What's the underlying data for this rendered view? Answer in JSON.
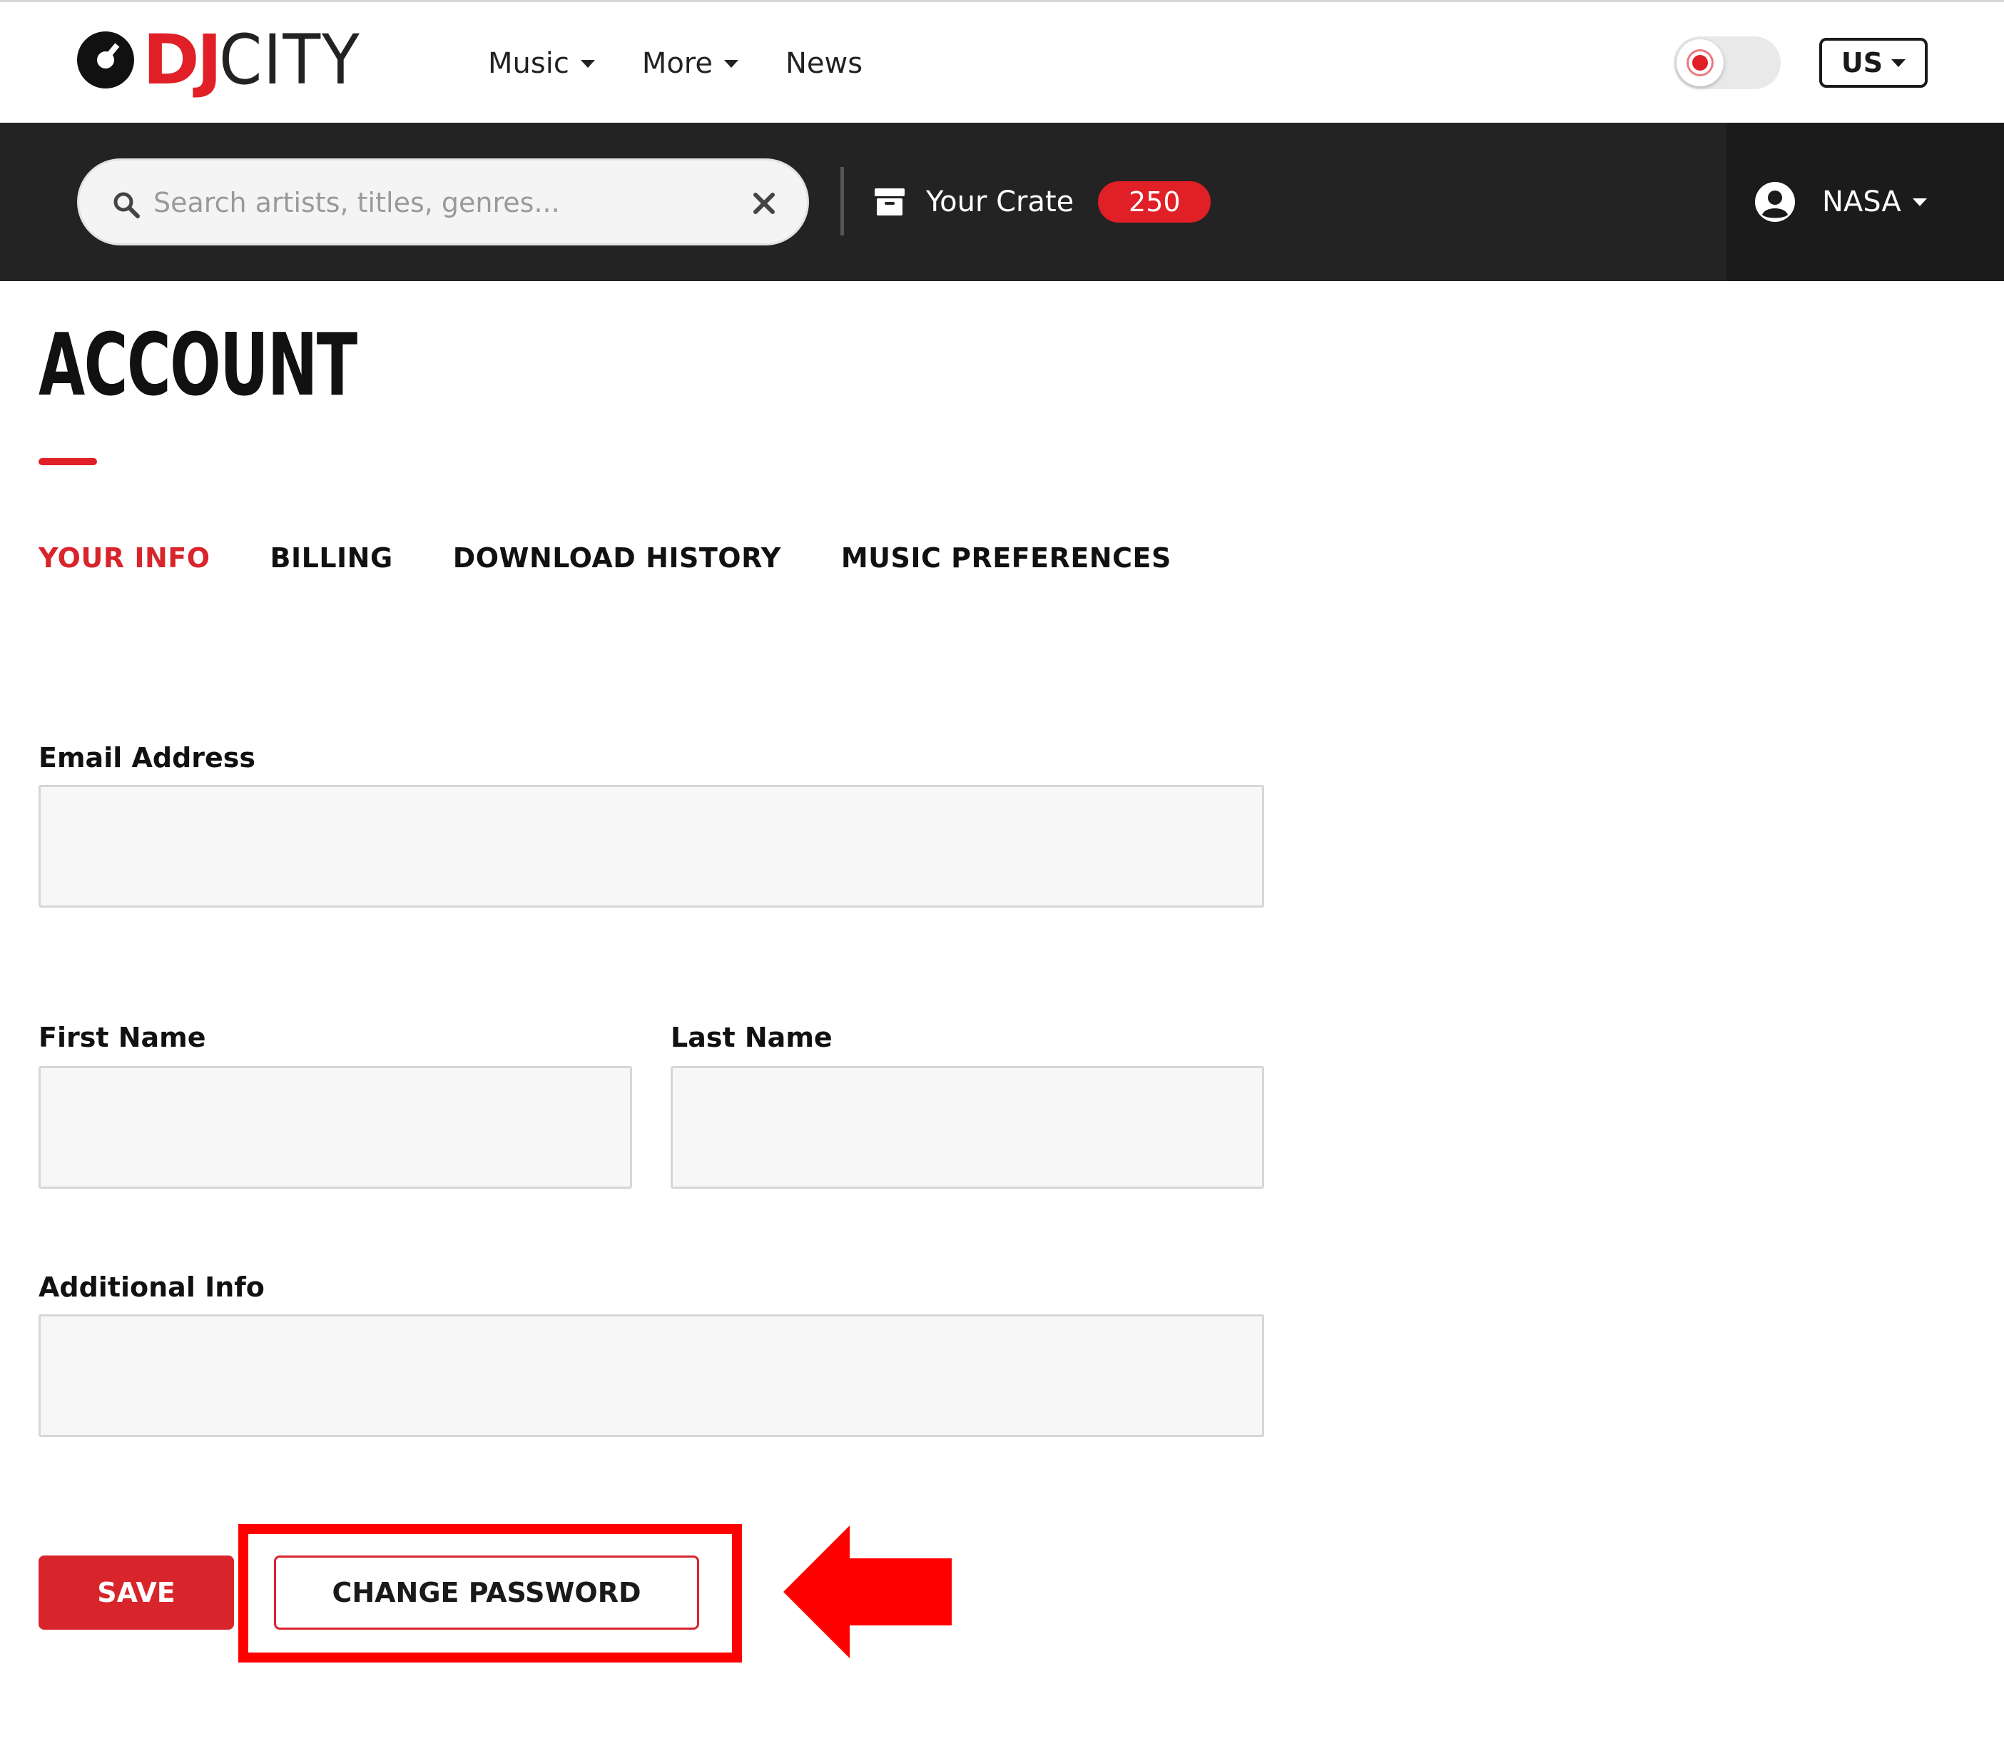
{
  "brand": {
    "logo_primary": "DJ",
    "logo_secondary": "CITY"
  },
  "nav": {
    "links": [
      {
        "label": "Music",
        "has_dropdown": true
      },
      {
        "label": "More",
        "has_dropdown": true
      },
      {
        "label": "News",
        "has_dropdown": false
      }
    ],
    "theme_toggle_icon": "sun-icon",
    "region_label": "US"
  },
  "toolbar": {
    "search_placeholder": "Search artists, titles, genres...",
    "search_value": "",
    "crate_label": "Your Crate",
    "crate_count": "250",
    "user_name": "NASA"
  },
  "page": {
    "title": "ACCOUNT",
    "tabs": [
      {
        "label": "YOUR INFO",
        "active": true
      },
      {
        "label": "BILLING",
        "active": false
      },
      {
        "label": "DOWNLOAD HISTORY",
        "active": false
      },
      {
        "label": "MUSIC PREFERENCES",
        "active": false
      }
    ]
  },
  "form": {
    "email_label": "Email Address",
    "email_value": "",
    "first_name_label": "First Name",
    "first_name_value": "",
    "last_name_label": "Last Name",
    "last_name_value": "",
    "additional_info_label": "Additional Info",
    "additional_info_value": "",
    "save_label": "SAVE",
    "change_password_label": "CHANGE PASSWORD"
  },
  "colors": {
    "brand_red": "#e01f26",
    "dark_bar": "#232323",
    "annotation_red": "#ff0000"
  }
}
